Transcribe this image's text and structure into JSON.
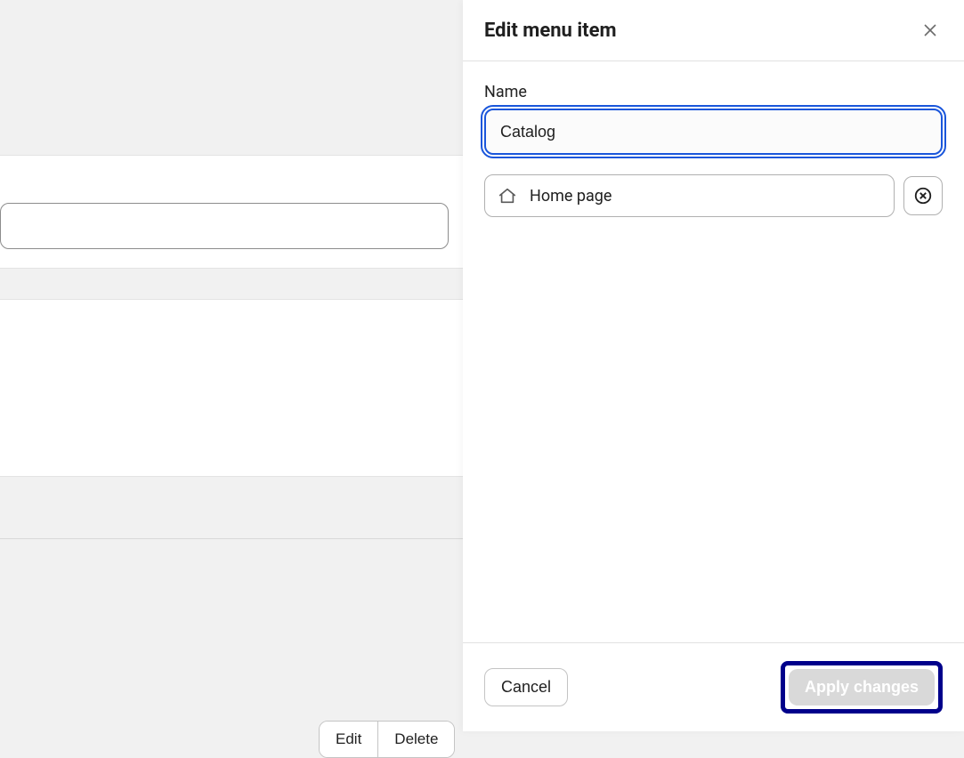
{
  "panel": {
    "title": "Edit menu item",
    "name_label": "Name",
    "name_value": "Catalog",
    "link_label": "Home page",
    "cancel_label": "Cancel",
    "apply_label": "Apply changes"
  },
  "background": {
    "edit_label": "Edit",
    "delete_label": "Delete"
  }
}
